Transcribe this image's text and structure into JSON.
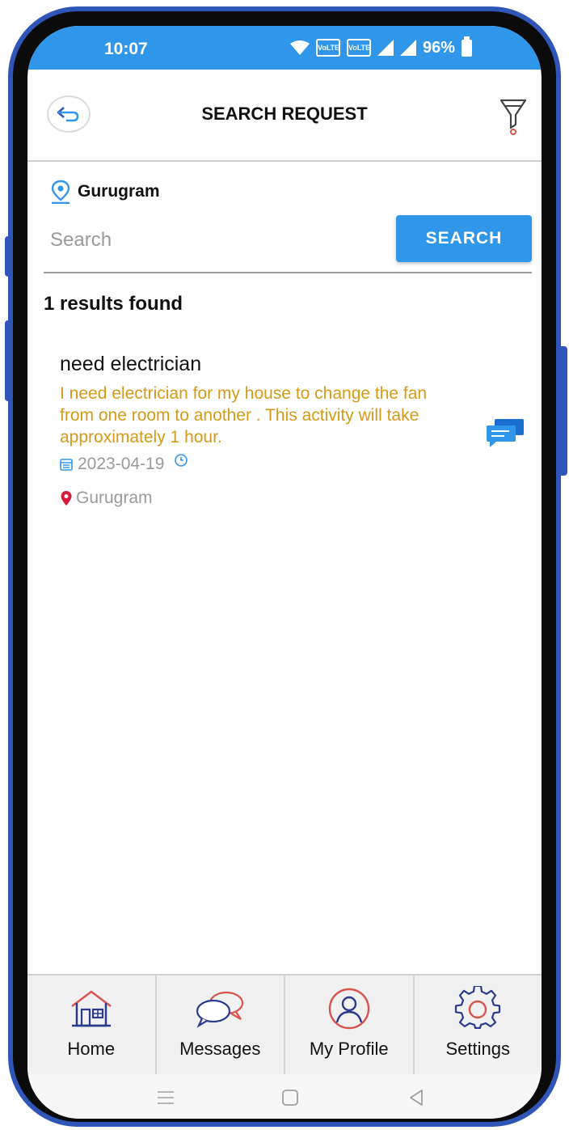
{
  "status_bar": {
    "time": "10:07",
    "battery": "96%",
    "sim1": "VoLTE",
    "sim2": "VoLTE"
  },
  "header": {
    "title": "SEARCH REQUEST"
  },
  "location": {
    "label": "Gurugram"
  },
  "search": {
    "placeholder": "Search",
    "button_label": "SEARCH"
  },
  "results_text": "1 results found",
  "results": [
    {
      "title": "need electrician",
      "description": "I need electrician for my house to  change the fan from one room to another . This activity will take approximately 1 hour.",
      "date": "2023-04-19",
      "location": "Gurugram"
    }
  ],
  "bottom_nav": [
    {
      "label": "Home",
      "icon": "home-icon"
    },
    {
      "label": "Messages",
      "icon": "messages-icon"
    },
    {
      "label": "My Profile",
      "icon": "profile-icon"
    },
    {
      "label": "Settings",
      "icon": "settings-icon"
    }
  ],
  "colors": {
    "accent": "#2f96ea",
    "description": "#d59a17",
    "frame": "#2f55b8",
    "icon_red": "#d9534f"
  }
}
